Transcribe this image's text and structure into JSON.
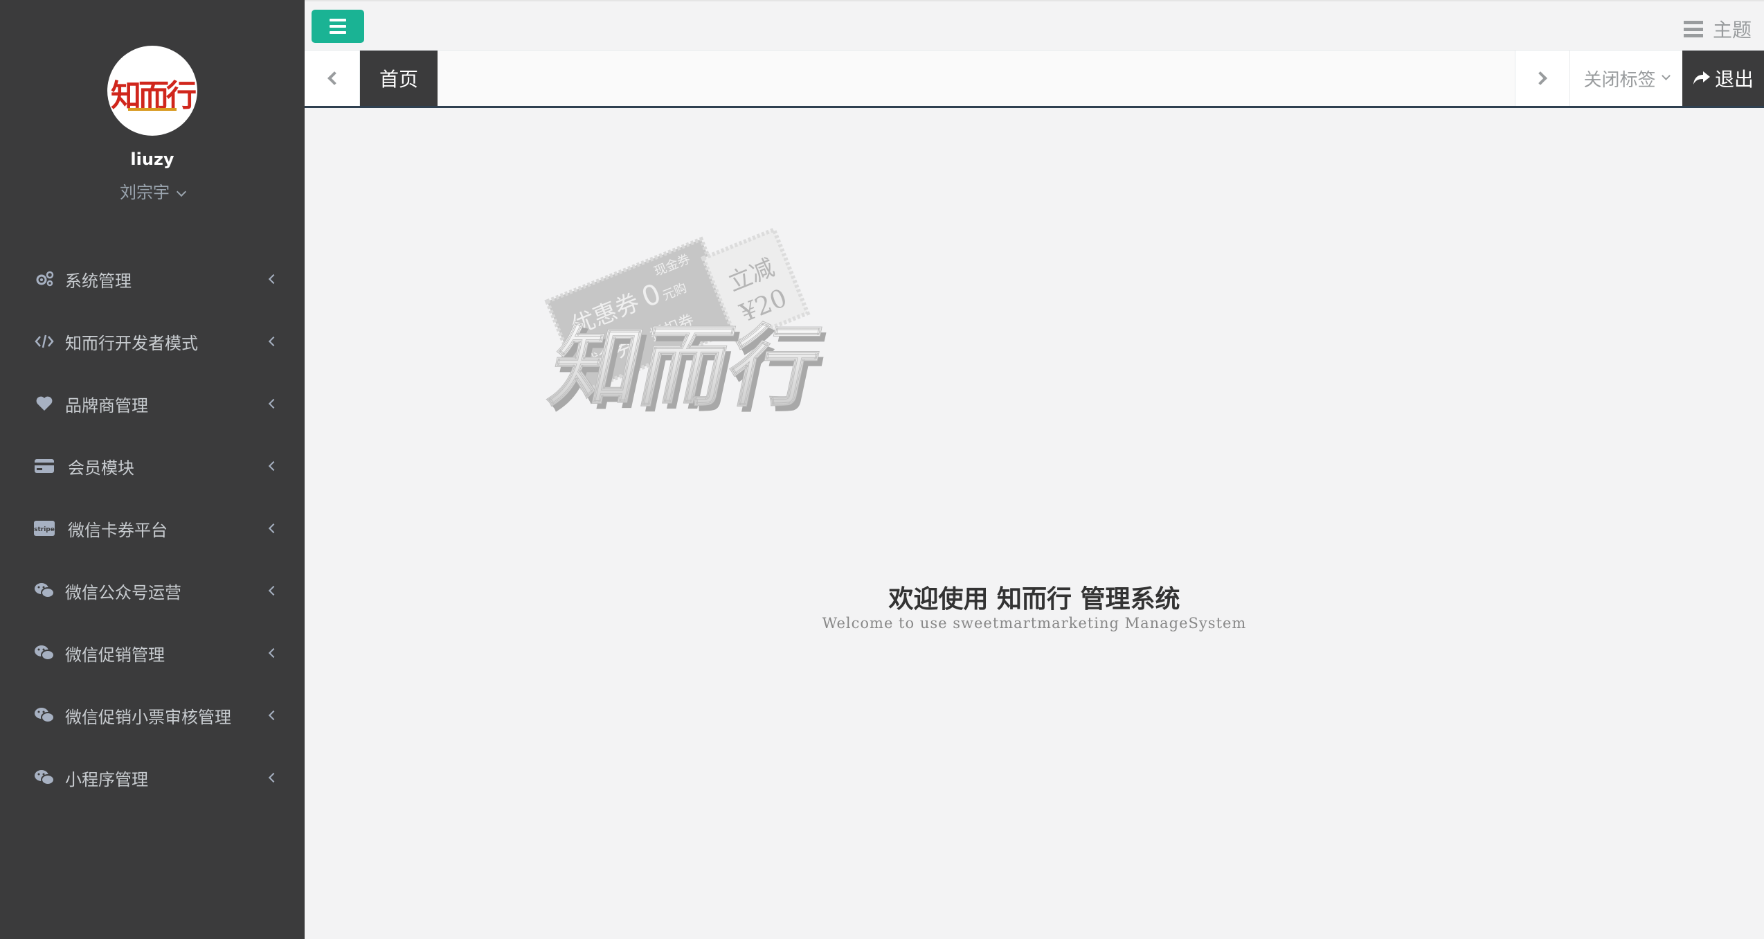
{
  "sidebar": {
    "avatar_text": "知而行",
    "username": "liuzy",
    "role": "刘宗宇",
    "items": [
      {
        "label": "系统管理",
        "icon": "gears-icon"
      },
      {
        "label": "知而行开发者模式",
        "icon": "code-icon"
      },
      {
        "label": "品牌商管理",
        "icon": "heart-icon"
      },
      {
        "label": "会员模块",
        "icon": "credit-card-icon"
      },
      {
        "label": "微信卡券平台",
        "icon": "stripe-icon"
      },
      {
        "label": "微信公众号运营",
        "icon": "wechat-icon"
      },
      {
        "label": "微信促销管理",
        "icon": "wechat-icon"
      },
      {
        "label": "微信促销小票审核管理",
        "icon": "wechat-icon"
      },
      {
        "label": "小程序管理",
        "icon": "wechat-icon"
      }
    ]
  },
  "topbar": {
    "theme_label": "主题"
  },
  "tabs": {
    "active_tab": "首页",
    "close_tabs_label": "关闭标签",
    "logout_label": "退出"
  },
  "welcome": {
    "coupon_left_lines": [
      "优惠券",
      "0",
      "元购",
      "代金",
      "券",
      "抵扣券",
      "现金券"
    ],
    "coupon_right_top": "立减",
    "coupon_right_bottom": "¥20",
    "logo_3d": "知而行",
    "title": "欢迎使用 知而行 管理系统",
    "subtitle": "Welcome to use sweetmartmarketing ManageSystem"
  },
  "colors": {
    "sidebar_bg": "#3b3b3c",
    "accent_green": "#1ab394",
    "content_bg": "#f3f3f4"
  }
}
